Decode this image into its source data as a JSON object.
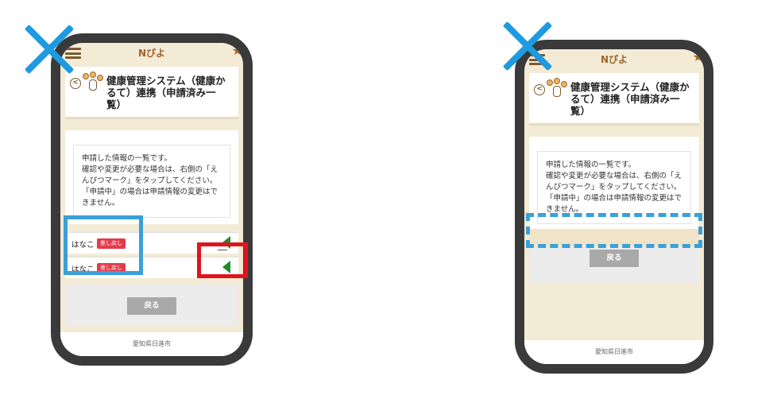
{
  "app": {
    "title": "Nぴよ"
  },
  "page": {
    "title": "健康管理システム（健康かるて）連携（申請済み一覧）"
  },
  "info": {
    "lines": [
      "申請した情報の一覧です。",
      "確認や変更が必要な場合は、右側の「え",
      "んぴつマーク」をタップしてください。",
      "「申請中」の場合は申請情報の変更はで",
      "きません。"
    ]
  },
  "rows": [
    {
      "name": "はなこ",
      "status": "差し戻し"
    },
    {
      "name": "はなこ",
      "status": "差し戻し"
    }
  ],
  "back_button": "戻る",
  "footer": "愛知県日進市",
  "colors": {
    "cross": "#1e9be0",
    "highlight_blue": "#3aa0d8",
    "highlight_red": "#e0141e",
    "badge": "#e23b4a",
    "brand": "#a0642a",
    "background": "#f3ebd6"
  }
}
